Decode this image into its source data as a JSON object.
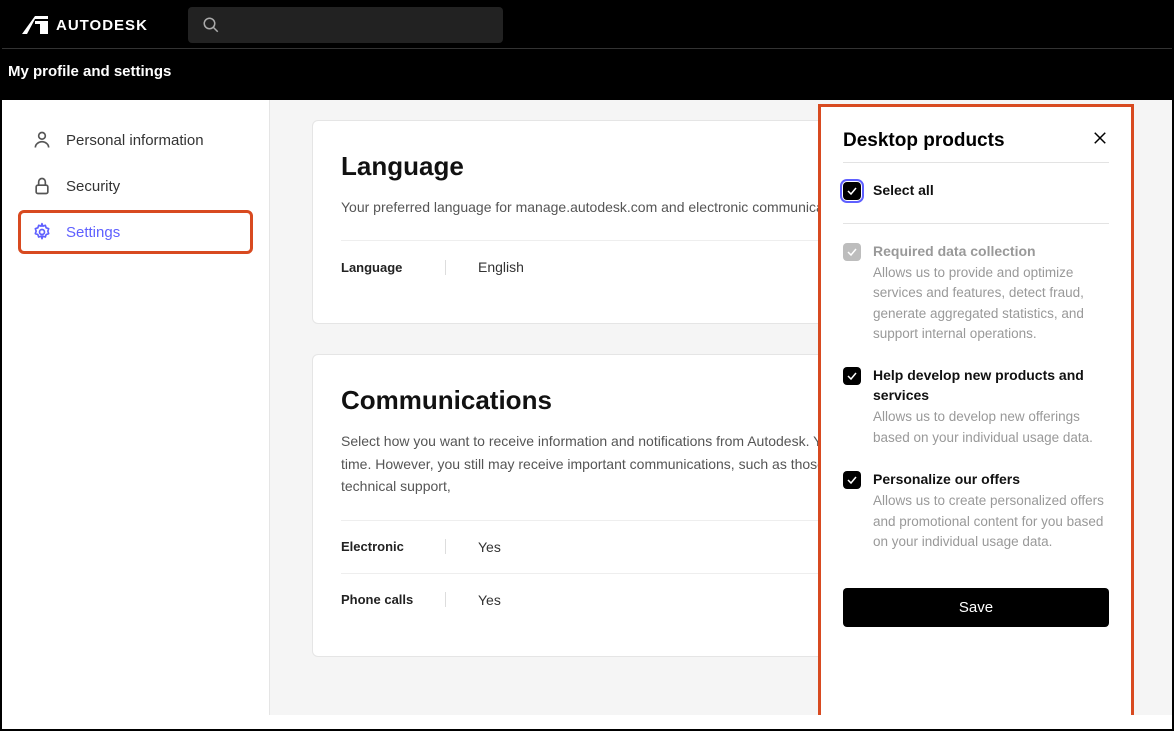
{
  "brand": "AUTODESK",
  "subheader": "My profile and settings",
  "sidebar": {
    "items": [
      {
        "label": "Personal information"
      },
      {
        "label": "Security"
      },
      {
        "label": "Settings"
      }
    ]
  },
  "language": {
    "title": "Language",
    "desc": "Your preferred language for manage.autodesk.com and electronic communications from Autodesk.",
    "field_label": "Language",
    "value": "English"
  },
  "communications": {
    "title": "Communications",
    "desc": "Select how you want to receive information and notifications from Autodesk. You can change these preferences at any time. However, you still may receive important communications, such as those about your account, products and services, technical support,",
    "fields": [
      {
        "label": "Electronic",
        "value": "Yes"
      },
      {
        "label": "Phone calls",
        "value": "Yes"
      }
    ]
  },
  "panel": {
    "title": "Desktop products",
    "select_all": "Select all",
    "opts": [
      {
        "title": "Required data collection",
        "sub": "Allows us to provide and optimize services and features, detect fraud, generate aggregated statistics, and support internal operations."
      },
      {
        "title": "Help develop new products and services",
        "sub": "Allows us to develop new offerings based on your individual usage data."
      },
      {
        "title": "Personalize our offers",
        "sub": "Allows us to create personalized offers and promotional content for you based on your individual usage data."
      }
    ],
    "save_label": "Save"
  }
}
